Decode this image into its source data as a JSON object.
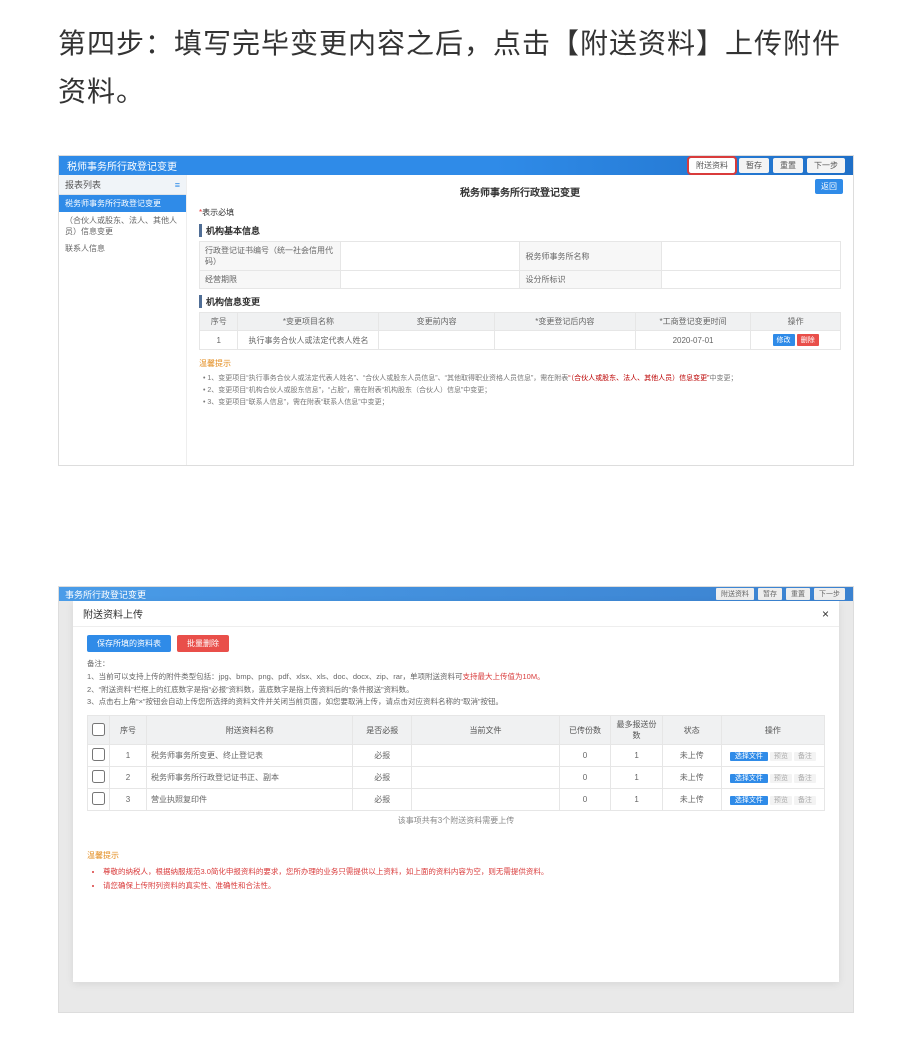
{
  "step_heading": "第四步：填写完毕变更内容之后，点击【附送资料】上传附件资料。",
  "shot1": {
    "bar_title": "税师事务所行政登记变更",
    "bar_btns": {
      "attach": "附送资料",
      "save": "暂存",
      "reset": "重置",
      "next": "下一步"
    },
    "sidebar": {
      "head": "报表列表",
      "items": [
        "税务师事务所行政登记变更",
        "（合伙人或股东、法人、其他人员）信息变更",
        "联系人信息"
      ]
    },
    "main_title": "税务师事务所行政登记变更",
    "return_btn": "返回",
    "req_tip": "表示必填",
    "sec_basic": "机构基本信息",
    "basic_rows": [
      {
        "l1": "行政登记证书编号（统一社会信用代码）",
        "l2": "税务师事务所名称"
      },
      {
        "l1": "经营期限",
        "l2": "设分所标识"
      }
    ],
    "sec_change": "机构信息变更",
    "chg_headers": [
      "序号",
      "*变更项目名称",
      "变更前内容",
      "*变更登记后内容",
      "*工商登记变更时间",
      "操作"
    ],
    "chg_row": {
      "seq": "1",
      "item": "执行事务合伙人或法定代表人姓名",
      "before": "",
      "after": "",
      "date": "2020-07-01",
      "ops": [
        "修改",
        "删除"
      ]
    },
    "warn_heading": "温馨提示",
    "warns": [
      {
        "pre": "• 1、变更项目“执行事务合伙人或法定代表人姓名”、“合伙人或股东人员信息”、“其他取得职业资格人员信息”，需在附表",
        "red": "“（合伙人或股东、法人、其他人员）信息变更”",
        "post": "中变更；"
      },
      {
        "pre": "• 2、变更项目“机构合伙人或股东信息”，“占股”，需在附表“机构股东（合伙人）信息”中变更；",
        "red": "",
        "post": ""
      },
      {
        "pre": "• 3、变更项目“联系人信息”，需在附表“联系人信息”中变更；",
        "red": "",
        "post": ""
      }
    ]
  },
  "shot2": {
    "bg_title": "事务所行政登记变更",
    "bg_btns": [
      "附送资料",
      "暂存",
      "重置",
      "下一步"
    ],
    "modal_title": "附送资料上传",
    "btn_save": "保存所填的资料表",
    "btn_delall": "批量删除",
    "notes_head": "备注：",
    "notes": [
      {
        "t": "1、当前可以支持上传的附件类型包括：jpg、bmp、png、pdf、xlsx、xls、doc、docx、zip、rar，单项附送资料可",
        "hl": "支持最大上传值为10M。",
        "post": ""
      },
      {
        "t": "2、“附送资料”栏框上的红底数字是指“必报”资料数，蓝底数字是指上传资料后的“条件报送”资料数。",
        "hl": "",
        "post": ""
      },
      {
        "t": "3、点击右上角“×”按钮会自动上传您所选择的资料文件并关闭当前页面，如您要取消上传，请点击对应资料名称的“取消”按钮。",
        "hl": "",
        "post": ""
      }
    ],
    "up_headers": [
      "",
      "序号",
      "附送资料名称",
      "是否必报",
      "当前文件",
      "已传份数",
      "最多报送份数",
      "状态",
      "操作"
    ],
    "up_rows": [
      {
        "seq": "1",
        "name": "税务师事务所变更、终止登记表",
        "req": "必报",
        "cur": "",
        "done": "0",
        "max": "1",
        "status": "未上传",
        "ops": [
          "选择文件",
          "预览",
          "备注"
        ]
      },
      {
        "seq": "2",
        "name": "税务师事务所行政登记证书正、副本",
        "req": "必报",
        "cur": "",
        "done": "0",
        "max": "1",
        "status": "未上传",
        "ops": [
          "选择文件",
          "预览",
          "备注"
        ]
      },
      {
        "seq": "3",
        "name": "营业执照复印件",
        "req": "必报",
        "cur": "",
        "done": "0",
        "max": "1",
        "status": "未上传",
        "ops": [
          "选择文件",
          "预览",
          "备注"
        ]
      }
    ],
    "below_note": "该事项共有3个附送资料需要上传",
    "warn_heading": "温馨提示",
    "warns2": [
      "尊敬的纳税人，根据纳服规范3.0简化申报资料的要求，您所办理的业务只需提供以上资料，如上面的资料内容为空，则无需提供资料。",
      "请您确保上传附列资料的真实性、准确性和合法性。"
    ]
  }
}
